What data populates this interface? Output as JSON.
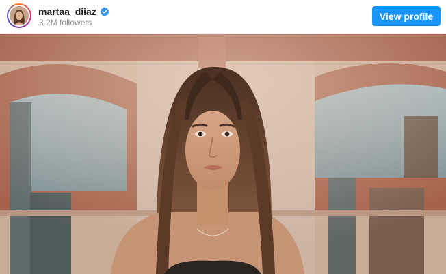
{
  "post_header": {
    "username": "martaa_diiaz",
    "verified_icon": "verified-badge-icon",
    "followers": "3.2M followers",
    "view_profile_label": "View profile"
  },
  "colors": {
    "button_blue": "#1a95f5",
    "verified_blue": "#3897f0",
    "username_text": "#262626",
    "secondary_text": "#8e8e8e"
  }
}
